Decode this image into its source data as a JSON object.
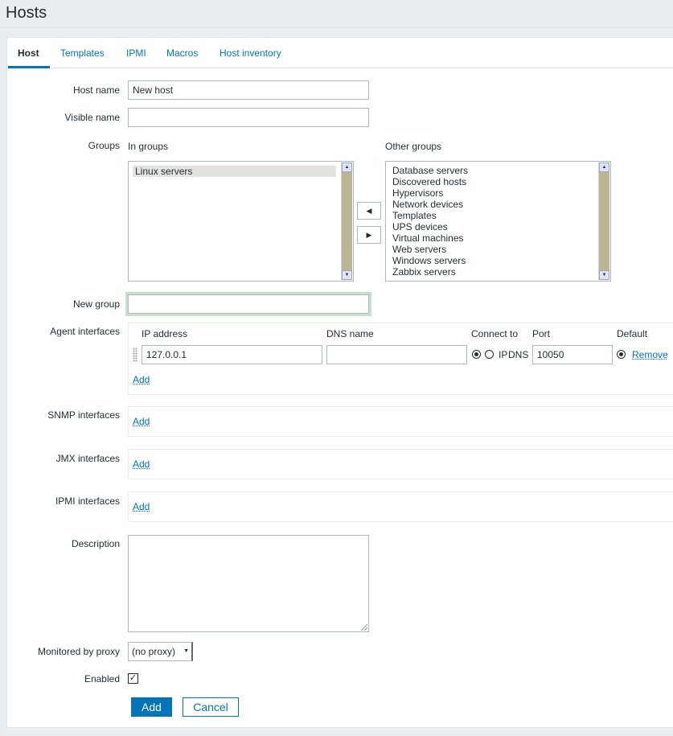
{
  "page": {
    "title": "Hosts"
  },
  "tabs": [
    {
      "label": "Host"
    },
    {
      "label": "Templates"
    },
    {
      "label": "IPMI"
    },
    {
      "label": "Macros"
    },
    {
      "label": "Host inventory"
    }
  ],
  "form": {
    "host_name": {
      "label": "Host name",
      "value": "New host"
    },
    "visible_name": {
      "label": "Visible name",
      "value": ""
    },
    "groups": {
      "label": "Groups",
      "in_groups_label": "In groups",
      "other_groups_label": "Other groups",
      "in_groups": [
        "Linux servers"
      ],
      "other_groups": [
        "Database servers",
        "Discovered hosts",
        "Hypervisors",
        "Network devices",
        "Templates",
        "UPS devices",
        "Virtual machines",
        "Web servers",
        "Windows servers",
        "Zabbix servers"
      ]
    },
    "new_group": {
      "label": "New group",
      "value": ""
    },
    "agent_interfaces": {
      "label": "Agent interfaces",
      "col_ip": "IP address",
      "col_dns": "DNS name",
      "col_connect": "Connect to",
      "col_port": "Port",
      "col_default": "Default",
      "row": {
        "ip": "127.0.0.1",
        "dns": "",
        "connect_ip": "IP",
        "connect_dns": "DNS",
        "port": "10050",
        "remove": "Remove"
      },
      "add": "Add"
    },
    "snmp_interfaces": {
      "label": "SNMP interfaces",
      "add": "Add"
    },
    "jmx_interfaces": {
      "label": "JMX interfaces",
      "add": "Add"
    },
    "ipmi_interfaces": {
      "label": "IPMI interfaces",
      "add": "Add"
    },
    "description": {
      "label": "Description",
      "value": ""
    },
    "proxy": {
      "label": "Monitored by proxy",
      "value": "(no proxy)"
    },
    "enabled": {
      "label": "Enabled",
      "check": "✓"
    },
    "buttons": {
      "add": "Add",
      "cancel": "Cancel"
    }
  },
  "icons": {
    "left_arrow": "◀",
    "right_arrow": "▶",
    "scroll_up": "▲",
    "scroll_down": "▼",
    "caret": "▼"
  }
}
